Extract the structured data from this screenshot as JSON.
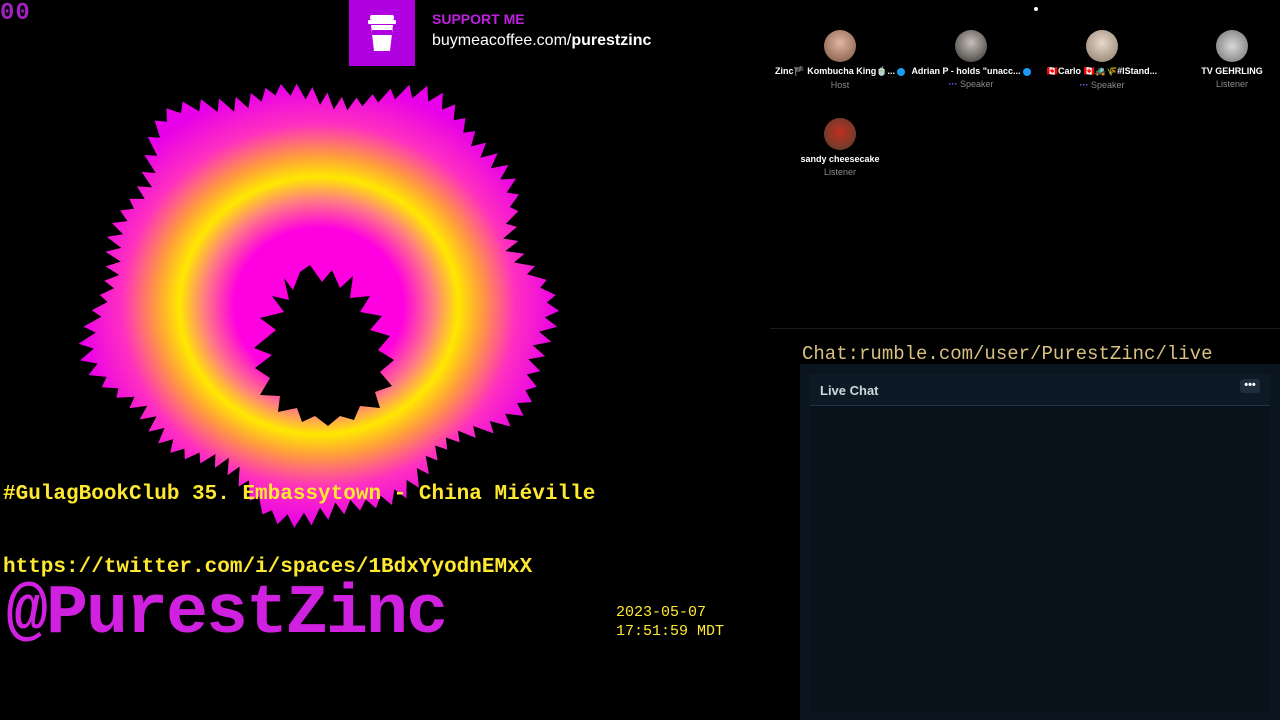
{
  "overlay": {
    "counter": "00",
    "support_label": "SUPPORT ME",
    "support_url_prefix": "buymeacoffee.com/",
    "support_url_handle": "purestzinc",
    "title": "#GulagBookClub 35. Embassytown - China Miéville",
    "space_url": "https://twitter.com/i/spaces/1BdxYyodnEMxX",
    "handle": "@PurestZinc",
    "date": "2023-05-07",
    "time": "17:51:59 MDT",
    "chat_url": "Chat:rumble.com/user/PurestZinc/live"
  },
  "participants": [
    {
      "name": "Zinc🏴 Kombucha King🍵...",
      "role": "Host",
      "speaking": false,
      "verified": true
    },
    {
      "name": "Adrian P - holds \"unacc...",
      "role": "Speaker",
      "speaking": true,
      "verified": true
    },
    {
      "name": "🇨🇦Carlo 🇨🇦🚜🌾#IStand...",
      "role": "Speaker",
      "speaking": true,
      "verified": false
    },
    {
      "name": "TV GEHRLING",
      "role": "Listener",
      "speaking": false,
      "verified": false
    },
    {
      "name": "sandy cheesecake",
      "role": "Listener",
      "speaking": false,
      "verified": false
    }
  ],
  "chat": {
    "title": "Live Chat",
    "menu_icon": "more-horizontal-icon",
    "menu_glyph": "•••"
  },
  "colors": {
    "accent_magenta": "#d020e0",
    "accent_yellow": "#ffe830",
    "chat_bg": "#0b1520"
  }
}
